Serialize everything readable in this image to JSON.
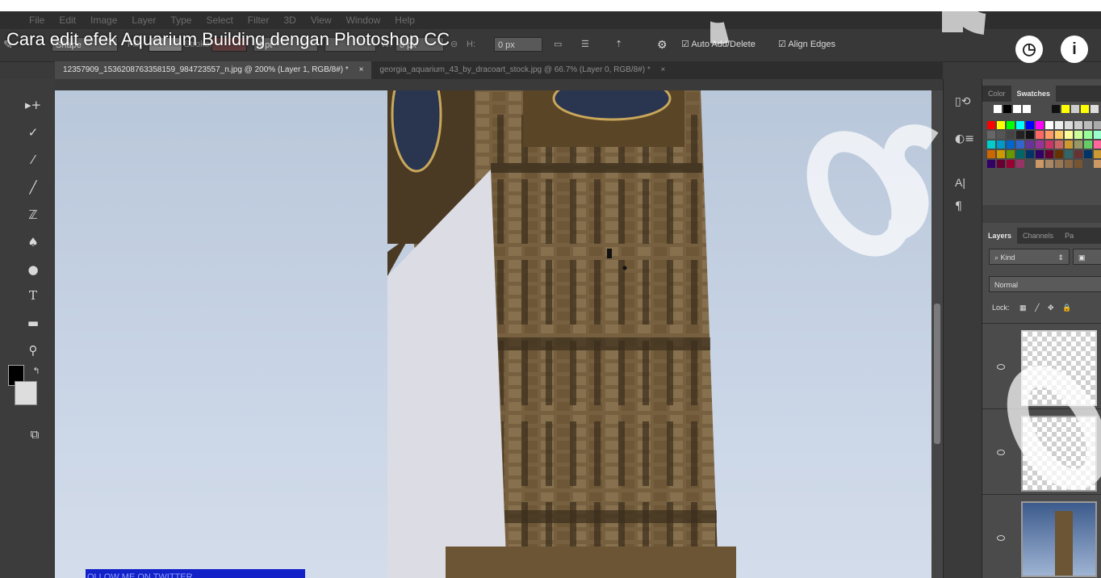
{
  "video": {
    "title": "Cara edit efek Aquarium Building dengan Photoshop CC",
    "banner_text": "OLLOW ME ON TWITTER"
  },
  "menu": [
    "File",
    "Edit",
    "Image",
    "Layer",
    "Type",
    "Select",
    "Filter",
    "3D",
    "View",
    "Window",
    "Help"
  ],
  "options_bar": {
    "shape_mode": "Shape",
    "fill_label": "Fill:",
    "stroke_label": "Stroke:",
    "stroke_width": "4 pt",
    "w_label": "W:",
    "w_value": "0 px",
    "h_label": "H:",
    "h_value": "0 px",
    "auto_add_delete": "Auto Add/Delete",
    "align_edges": "Align Edges"
  },
  "document_tabs": [
    {
      "label": "12357909_1536208763358159_984723557_n.jpg @ 200% (Layer 1, RGB/8#) *",
      "active": true
    },
    {
      "label": "georgia_aquarium_43_by_dracoart_stock.jpg @ 66.7% (Layer 0, RGB/8#) *",
      "active": false
    }
  ],
  "panels": {
    "color_tabs": [
      "Color",
      "Swatches"
    ],
    "layers_tabs": [
      "Layers",
      "Channels",
      "Pa"
    ],
    "kind_filter": "Kind",
    "blend_mode": "Normal",
    "lock_label": "Lock:"
  },
  "colors": {
    "app_bg": "#3a3a3a",
    "panel_bg": "#4b4b4b",
    "sky": "#c6d2e3",
    "stone": "#7d6545",
    "white_panel": "#dcdde4",
    "banner": "#1322c8"
  },
  "icons": [
    "clock-icon",
    "info-icon"
  ]
}
